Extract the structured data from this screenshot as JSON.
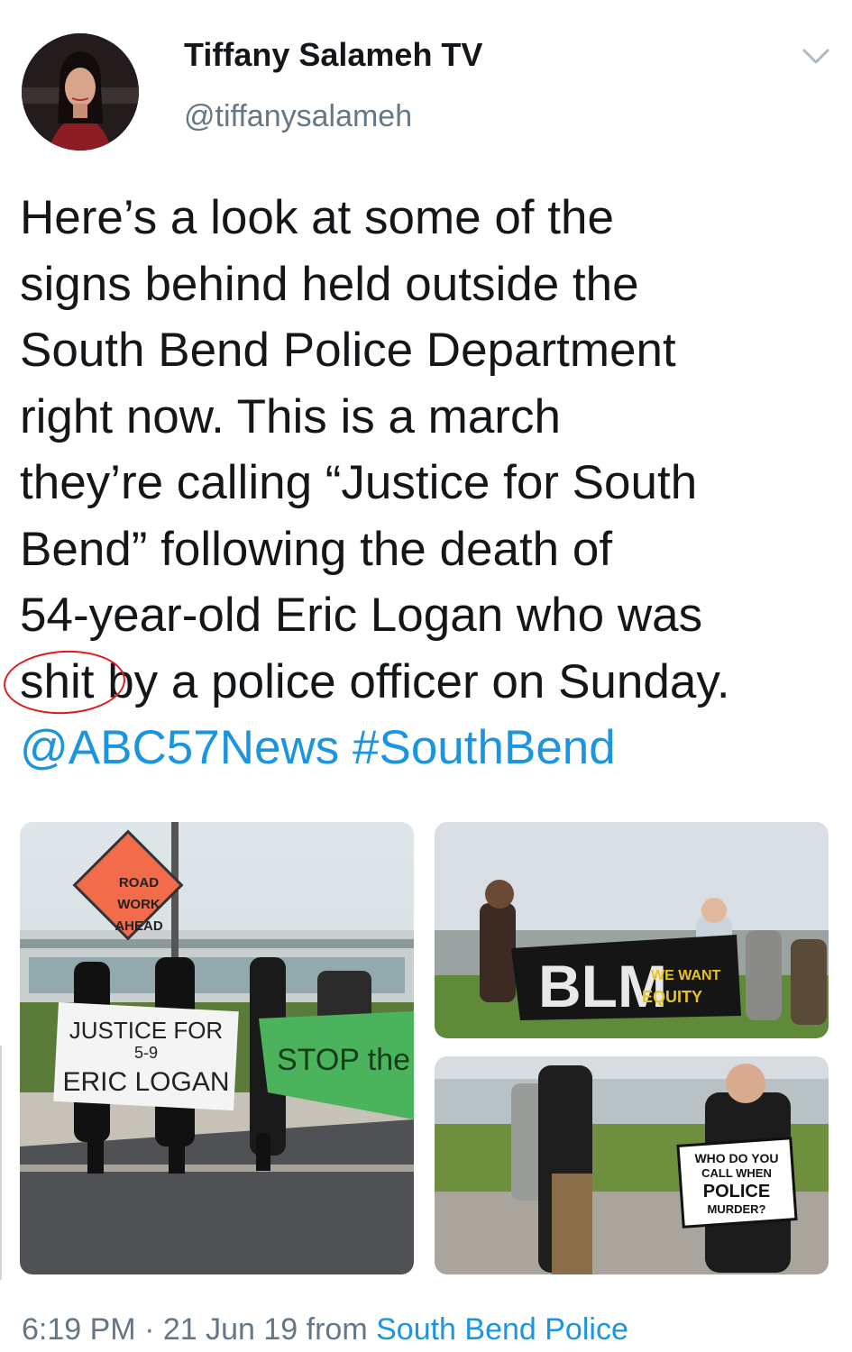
{
  "user": {
    "display_name": "Tiffany Salameh TV",
    "handle": "@tiffanysalameh"
  },
  "tweet": {
    "lines": [
      "Here’s a look at some of the",
      "signs behind held outside the",
      "South Bend Police Department",
      "right now. This is a march",
      "they’re calling “Justice for South",
      "Bend” following the death of",
      "54-year-old Eric Logan who was"
    ],
    "last_line_circled_word": "shit",
    "last_line_rest": " by a police officer on Sunday.",
    "mention": "@ABC57News",
    "hashtag": "#SouthBend"
  },
  "photos": {
    "sign_road": [
      "ROAD",
      "WORK",
      "AHEAD"
    ],
    "banner_justice": [
      "JUSTICE FOR",
      "5-9",
      "ERIC LOGAN"
    ],
    "banner_stop": "STOP the",
    "banner_blm": "BLM",
    "banner_equity": [
      "WE WANT",
      "EQUITY"
    ],
    "sign_police": [
      "WHO DO YOU",
      "CALL WHEN",
      "POLICE",
      "MURDER?"
    ]
  },
  "meta": {
    "time": "6:19 PM",
    "separator": " · ",
    "date": "21 Jun 19",
    "from": " from ",
    "source": "South Bend Police"
  },
  "colors": {
    "link": "#1b95e0",
    "muted": "#657786",
    "annotation": "#e01b1b"
  }
}
